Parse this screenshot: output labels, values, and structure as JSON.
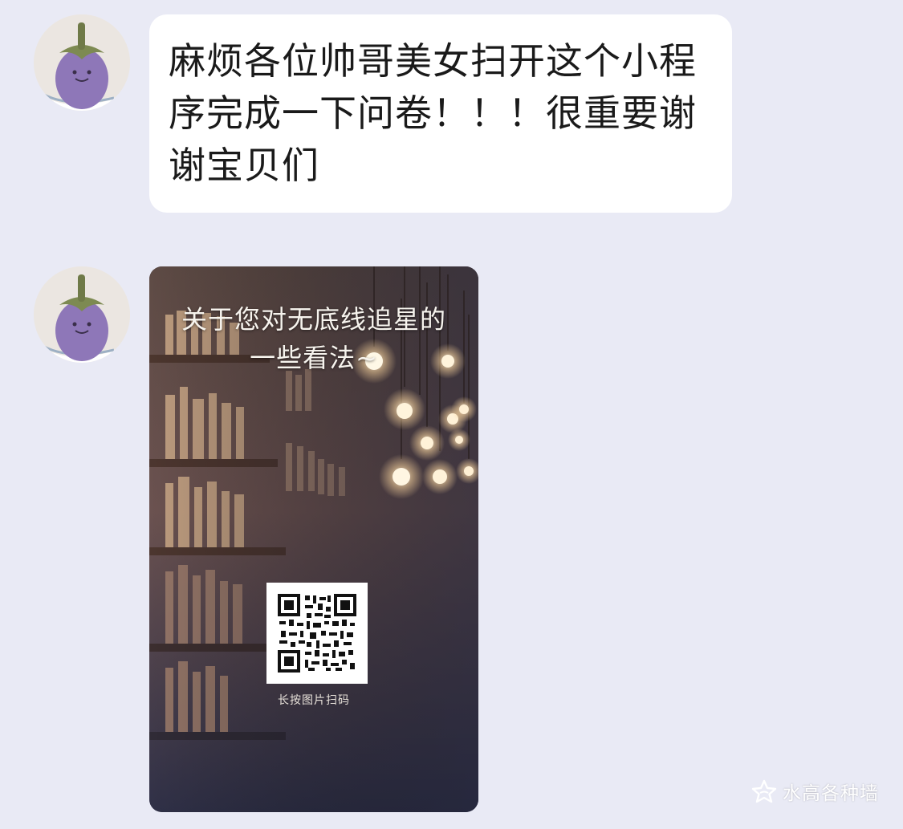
{
  "messages": [
    {
      "type": "text",
      "lines": [
        "麻烦各位帅哥美女扫开这个小程",
        "序完成一下问卷！！！很重要谢",
        "谢宝贝们"
      ]
    },
    {
      "type": "image",
      "poster": {
        "title_line1": "关于您对无底线追星的",
        "title_line2": "一些看法~",
        "qr_caption": "长按图片扫码"
      }
    }
  ],
  "watermark": {
    "text": "水高各种墙",
    "icon": "star-logo-icon"
  },
  "colors": {
    "background": "#e9eaf5",
    "bubble": "#ffffff",
    "text": "#1a1a1a"
  }
}
